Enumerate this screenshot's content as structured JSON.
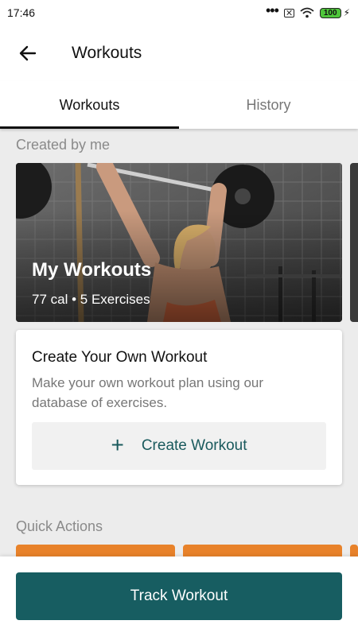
{
  "status_bar": {
    "time": "17:46",
    "battery": "100"
  },
  "app_bar": {
    "title": "Workouts"
  },
  "tabs": [
    {
      "label": "Workouts",
      "active": true
    },
    {
      "label": "History",
      "active": false
    }
  ],
  "created_by_me": {
    "section_title": "Created by me",
    "card": {
      "title": "My Workouts",
      "subtitle": "77 cal • 5 Exercises"
    }
  },
  "create_workout": {
    "title": "Create Your Own Workout",
    "description": "Make your own workout plan using our database of exercises.",
    "button_label": "Create Workout",
    "button_icon": "plus-icon"
  },
  "quick_actions": {
    "section_title": "Quick Actions"
  },
  "bottom": {
    "track_label": "Track Workout"
  },
  "colors": {
    "primary": "#175d61",
    "accent_orange": "#e8822a",
    "background": "#ececec"
  }
}
